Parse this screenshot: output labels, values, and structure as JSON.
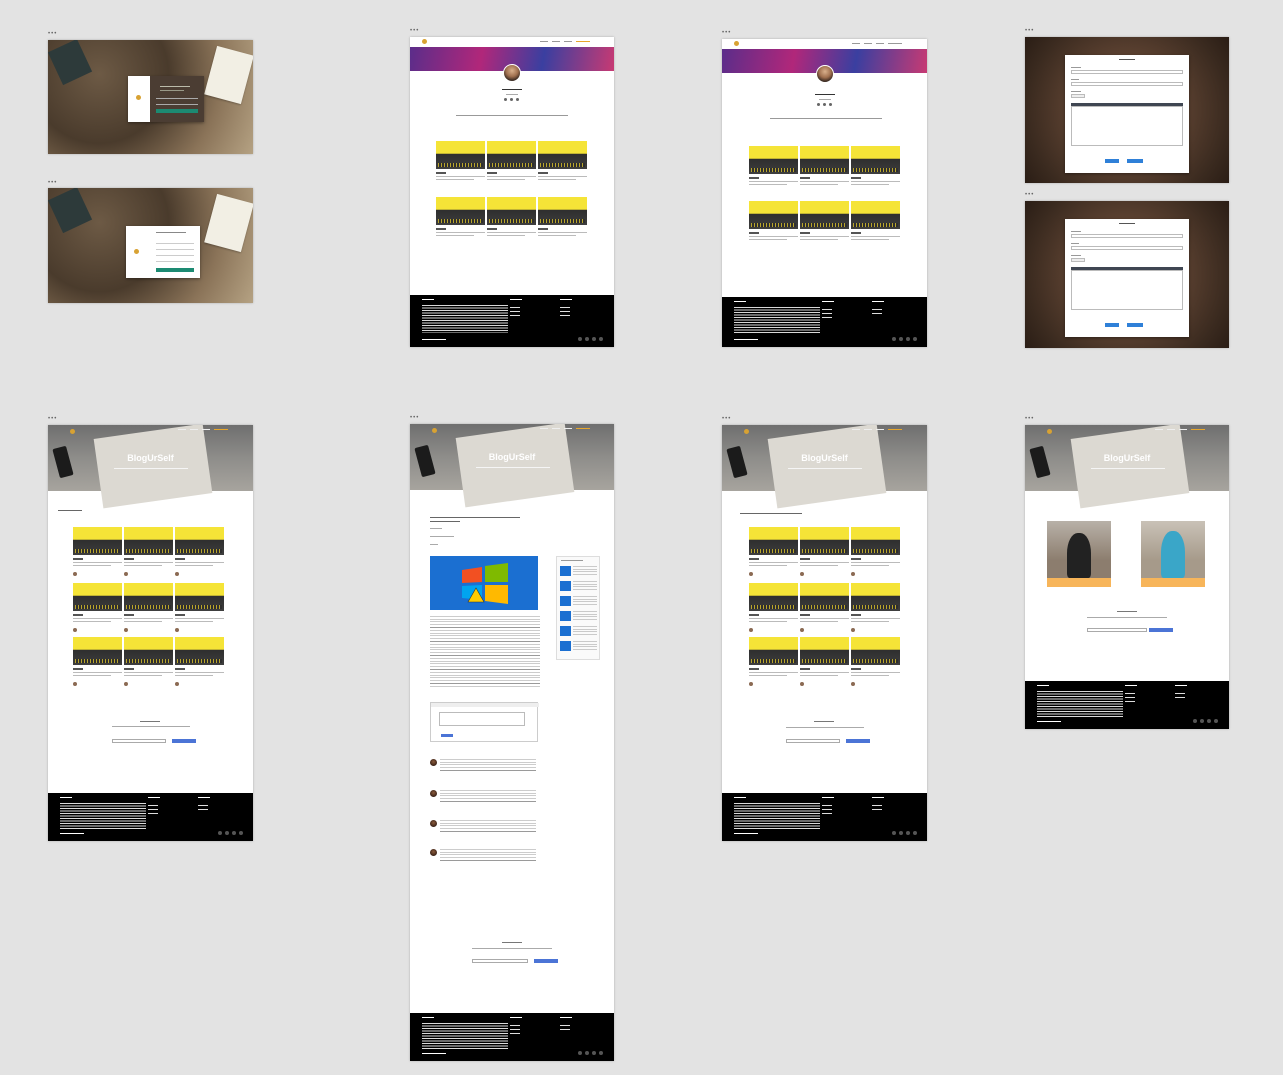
{
  "canvas": {
    "background": "#e3e3e3"
  },
  "artboard_menu": "•••",
  "brand": {
    "logo_text": "BlogUrSelf",
    "hero_title": "BlogUrSelf",
    "accent_color": "#e8a72c",
    "button_color": "#4b74d6",
    "footer_color": "#000000"
  },
  "icons": [
    "menu-dots-icon",
    "logo-icon",
    "windows-logo-icon",
    "social-icon"
  ]
}
